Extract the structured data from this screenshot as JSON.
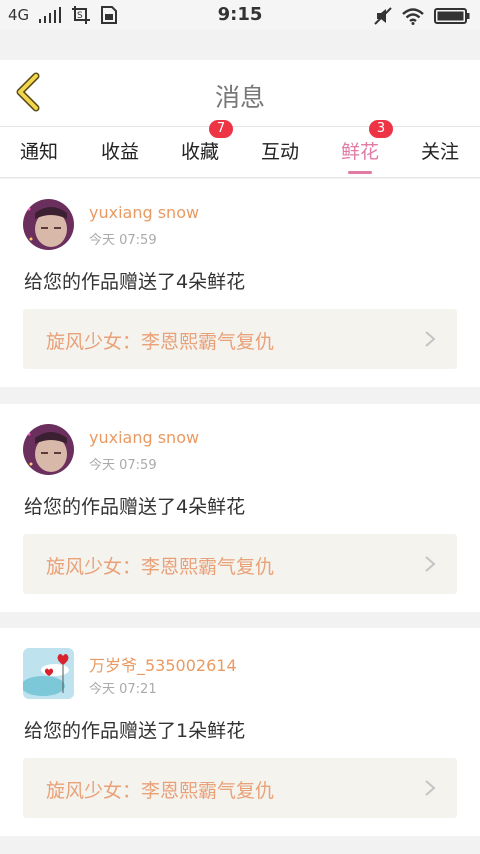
{
  "status_bar": {
    "network": "4G",
    "time": "9:15"
  },
  "header": {
    "title": "消息",
    "back_icon": "chevron-left-icon"
  },
  "tabs": [
    {
      "label": "通知",
      "badge": ""
    },
    {
      "label": "收益",
      "badge": ""
    },
    {
      "label": "收藏",
      "badge": "7"
    },
    {
      "label": "互动",
      "badge": ""
    },
    {
      "label": "鲜花",
      "badge": "3",
      "active": true
    },
    {
      "label": "关注",
      "badge": ""
    }
  ],
  "colors": {
    "accent": "#e27aa4",
    "username": "#e99a62",
    "work_title": "#e9a179",
    "badge": "#ee3344"
  },
  "messages": [
    {
      "username": "yuxiang snow",
      "time": "今天 07:59",
      "text": "给您的作品赠送了4朵鲜花",
      "work_title": "旋风少女：李恩熙霸气复仇"
    },
    {
      "username": "yuxiang snow",
      "time": "今天 07:59",
      "text": "给您的作品赠送了4朵鲜花",
      "work_title": "旋风少女：李恩熙霸气复仇"
    },
    {
      "username": "万岁爷_535002614",
      "time": "今天 07:21",
      "text": "给您的作品赠送了1朵鲜花",
      "work_title": "旋风少女：李恩熙霸气复仇"
    }
  ]
}
